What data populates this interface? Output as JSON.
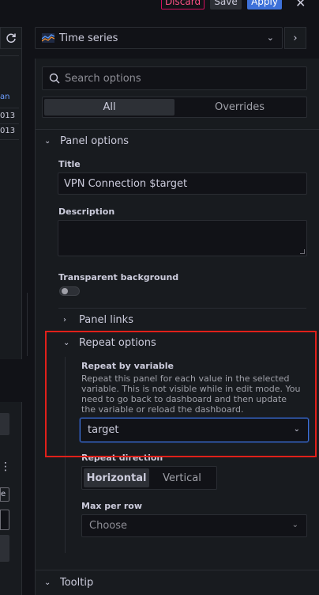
{
  "toolbar": {
    "discard": "Discard",
    "save": "Save",
    "apply": "Apply",
    "close": "✕"
  },
  "left": {
    "link_fragment": "an",
    "row1": "013",
    "row2": "013",
    "small_e": "e"
  },
  "viz": {
    "label": "Time series",
    "icon": "time-series-icon"
  },
  "search": {
    "placeholder": "Search options"
  },
  "tabs": [
    {
      "label": "All"
    },
    {
      "label": "Overrides"
    }
  ],
  "panel_options": {
    "header": "Panel options",
    "title_label": "Title",
    "title_value": "VPN Connection $target",
    "description_label": "Description",
    "transparent_label": "Transparent background"
  },
  "panel_links": {
    "header": "Panel links"
  },
  "repeat_options": {
    "header": "Repeat options",
    "repeat_by_label": "Repeat by variable",
    "repeat_by_desc": "Repeat this panel for each value in the selected variable. This is not visible while in edit mode. You need to go back to dashboard and then update the variable or reload the dashboard.",
    "repeat_by_value": "target",
    "direction_label": "Repeat direction",
    "directions": [
      "Horizontal",
      "Vertical"
    ],
    "max_per_row_label": "Max per row",
    "max_per_row_placeholder": "Choose"
  },
  "tooltip": {
    "header": "Tooltip"
  },
  "colors": {
    "accent": "#3d71d9",
    "highlight": "#e0201a",
    "discard": "#ff5286"
  }
}
